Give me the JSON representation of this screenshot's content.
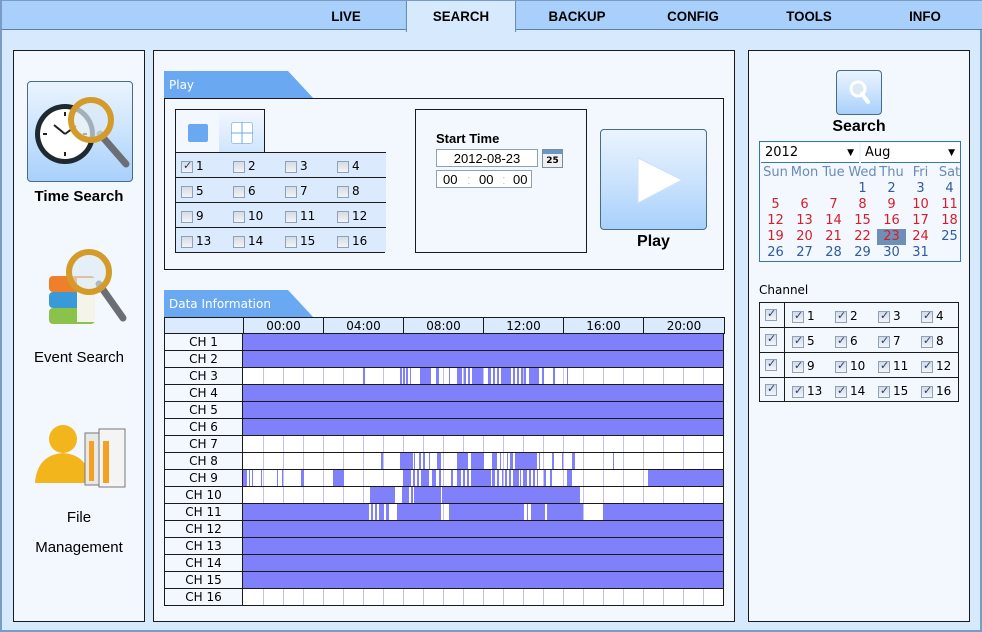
{
  "nav": {
    "tabs": [
      {
        "label": "LIVE",
        "active": false
      },
      {
        "label": "SEARCH",
        "active": true
      },
      {
        "label": "BACKUP",
        "active": false
      },
      {
        "label": "CONFIG",
        "active": false
      },
      {
        "label": "TOOLS",
        "active": false
      },
      {
        "label": "INFO",
        "active": false
      }
    ]
  },
  "sidebar": {
    "items": [
      {
        "label": "Time Search",
        "icon": "clock-magnifier-icon",
        "selected": true
      },
      {
        "label": "Event Search",
        "icon": "books-magnifier-icon",
        "selected": false
      },
      {
        "label_line1": "File",
        "label_line2": "Management",
        "icon": "user-files-icon",
        "selected": false
      }
    ]
  },
  "play_section": {
    "title": "Play",
    "layout_tabs": [
      {
        "name": "single-view",
        "active": true
      },
      {
        "name": "quad-view",
        "active": false
      }
    ],
    "channels": [
      {
        "label": "1",
        "checked": true
      },
      {
        "label": "2",
        "checked": false
      },
      {
        "label": "3",
        "checked": false
      },
      {
        "label": "4",
        "checked": false
      },
      {
        "label": "5",
        "checked": false
      },
      {
        "label": "6",
        "checked": false
      },
      {
        "label": "7",
        "checked": false
      },
      {
        "label": "8",
        "checked": false
      },
      {
        "label": "9",
        "checked": false
      },
      {
        "label": "10",
        "checked": false
      },
      {
        "label": "11",
        "checked": false
      },
      {
        "label": "12",
        "checked": false
      },
      {
        "label": "13",
        "checked": false
      },
      {
        "label": "14",
        "checked": false
      },
      {
        "label": "15",
        "checked": false
      },
      {
        "label": "16",
        "checked": false
      }
    ],
    "start_time_label": "Start Time",
    "date_value": "2012-08-23",
    "calendar_icon_text": "25",
    "time_hh": "00",
    "time_mm": "00",
    "time_ss": "00",
    "time_sep": ":",
    "play_label": "Play"
  },
  "data_info": {
    "title": "Data Information",
    "time_headers": [
      "00:00",
      "04:00",
      "08:00",
      "12:00",
      "16:00",
      "20:00"
    ],
    "record_color": "#8080fa",
    "channels": [
      {
        "label": "CH 1",
        "segments": [
          [
            0,
            24
          ]
        ]
      },
      {
        "label": "CH 2",
        "segments": [
          [
            0,
            24
          ]
        ]
      },
      {
        "label": "CH 3",
        "segments": [
          [
            6.0,
            6.08
          ],
          [
            7.85,
            7.95
          ],
          [
            8.0,
            8.1
          ],
          [
            8.15,
            8.25
          ],
          [
            8.35,
            8.42
          ],
          [
            8.85,
            9.4
          ],
          [
            9.65,
            9.8
          ],
          [
            10.3,
            10.35
          ],
          [
            10.7,
            10.95
          ],
          [
            11.05,
            11.15
          ],
          [
            11.25,
            11.35
          ],
          [
            11.45,
            12.0
          ],
          [
            12.25,
            12.4
          ],
          [
            12.5,
            12.6
          ],
          [
            12.7,
            12.8
          ],
          [
            12.9,
            13.4
          ],
          [
            13.5,
            13.6
          ],
          [
            13.7,
            13.8
          ],
          [
            13.9,
            14.0
          ],
          [
            14.05,
            14.15
          ],
          [
            14.3,
            14.8
          ],
          [
            14.95,
            15.05
          ],
          [
            15.5,
            15.6
          ],
          [
            16.2,
            16.25
          ]
        ]
      },
      {
        "label": "CH 4",
        "segments": [
          [
            0,
            24
          ]
        ]
      },
      {
        "label": "CH 5",
        "segments": [
          [
            0,
            24
          ]
        ]
      },
      {
        "label": "CH 6",
        "segments": [
          [
            0,
            24
          ]
        ]
      },
      {
        "label": "CH 7",
        "segments": []
      },
      {
        "label": "CH 8",
        "segments": [
          [
            6.9,
            7.0
          ],
          [
            7.85,
            8.5
          ],
          [
            8.55,
            8.6
          ],
          [
            8.8,
            8.9
          ],
          [
            9.0,
            9.1
          ],
          [
            9.3,
            9.35
          ],
          [
            9.7,
            9.9
          ],
          [
            10.7,
            11.25
          ],
          [
            11.4,
            12.05
          ],
          [
            12.45,
            12.7
          ],
          [
            12.85,
            12.9
          ],
          [
            13.2,
            13.25
          ],
          [
            13.35,
            13.5
          ],
          [
            13.6,
            14.7
          ],
          [
            14.8,
            14.85
          ],
          [
            15.45,
            15.55
          ],
          [
            15.95,
            16.0
          ],
          [
            16.45,
            16.6
          ],
          [
            18.5,
            18.55
          ]
        ]
      },
      {
        "label": "CH 9",
        "segments": [
          [
            0,
            0.2
          ],
          [
            0.3,
            0.35
          ],
          [
            0.45,
            0.5
          ],
          [
            0.9,
            0.95
          ],
          [
            1.7,
            1.75
          ],
          [
            1.95,
            2.0
          ],
          [
            2.9,
            3.05
          ],
          [
            4.5,
            5.05
          ],
          [
            8.0,
            8.4
          ],
          [
            8.5,
            8.6
          ],
          [
            8.7,
            8.8
          ],
          [
            8.9,
            9.3
          ],
          [
            9.45,
            9.65
          ],
          [
            9.8,
            9.9
          ],
          [
            10.4,
            10.5
          ],
          [
            10.7,
            10.9
          ],
          [
            11.0,
            11.1
          ],
          [
            11.2,
            11.3
          ],
          [
            11.4,
            12.4
          ],
          [
            12.45,
            12.6
          ],
          [
            12.7,
            12.8
          ],
          [
            12.95,
            13.0
          ],
          [
            13.1,
            13.2
          ],
          [
            13.3,
            13.4
          ],
          [
            13.5,
            13.8
          ],
          [
            13.85,
            13.9
          ],
          [
            14.0,
            14.2
          ],
          [
            14.3,
            14.4
          ],
          [
            14.5,
            14.6
          ],
          [
            14.7,
            14.75
          ],
          [
            15.05,
            15.15
          ],
          [
            15.35,
            15.45
          ],
          [
            16.2,
            16.45
          ],
          [
            20.25,
            24
          ]
        ]
      },
      {
        "label": "CH 10",
        "segments": [
          [
            6.35,
            7.6
          ],
          [
            7.95,
            8.3
          ],
          [
            8.4,
            8.5
          ],
          [
            8.55,
            9.9
          ],
          [
            9.95,
            16.85
          ]
        ]
      },
      {
        "label": "CH 11",
        "segments": [
          [
            0,
            6.3
          ],
          [
            6.4,
            6.5
          ],
          [
            6.6,
            6.7
          ],
          [
            6.8,
            7.05
          ],
          [
            7.15,
            7.3
          ],
          [
            7.7,
            9.9
          ],
          [
            10.3,
            14.05
          ],
          [
            14.2,
            14.25
          ],
          [
            14.4,
            15.1
          ],
          [
            15.2,
            17.0
          ],
          [
            18.0,
            24
          ]
        ]
      },
      {
        "label": "CH 12",
        "segments": [
          [
            0,
            24
          ]
        ]
      },
      {
        "label": "CH 13",
        "segments": [
          [
            0,
            24
          ]
        ]
      },
      {
        "label": "CH 14",
        "segments": [
          [
            0,
            24
          ]
        ]
      },
      {
        "label": "CH 15",
        "segments": [
          [
            0,
            24
          ]
        ]
      },
      {
        "label": "CH 16",
        "segments": []
      }
    ]
  },
  "search_panel": {
    "search_label": "Search",
    "year_value": "2012",
    "month_value": "Aug",
    "weekdays": [
      "Sun",
      "Mon",
      "Tue",
      "Wed",
      "Thu",
      "Fri",
      "Sat"
    ],
    "first_weekday_index": 3,
    "days_in_month": 31,
    "selected_day": 23,
    "recorded_days": [
      5,
      6,
      7,
      8,
      9,
      10,
      11,
      12,
      13,
      14,
      15,
      16,
      17,
      18,
      19,
      20,
      21,
      22,
      23,
      24
    ],
    "colors": {
      "normal_day": "#2e5c9e",
      "recorded_day": "#d41f2a",
      "selected_bg": "#6e8fb6",
      "weekday_header": "#6a8bb8"
    },
    "channel_label": "Channel",
    "channel_rows": [
      {
        "row_checked": true,
        "channels": [
          {
            "label": "1",
            "checked": true
          },
          {
            "label": "2",
            "checked": true
          },
          {
            "label": "3",
            "checked": true
          },
          {
            "label": "4",
            "checked": true
          }
        ]
      },
      {
        "row_checked": true,
        "channels": [
          {
            "label": "5",
            "checked": true
          },
          {
            "label": "6",
            "checked": true
          },
          {
            "label": "7",
            "checked": true
          },
          {
            "label": "8",
            "checked": true
          }
        ]
      },
      {
        "row_checked": true,
        "channels": [
          {
            "label": "9",
            "checked": true
          },
          {
            "label": "10",
            "checked": true
          },
          {
            "label": "11",
            "checked": true
          },
          {
            "label": "12",
            "checked": true
          }
        ]
      },
      {
        "row_checked": true,
        "channels": [
          {
            "label": "13",
            "checked": true
          },
          {
            "label": "14",
            "checked": true
          },
          {
            "label": "15",
            "checked": true
          },
          {
            "label": "16",
            "checked": true
          }
        ]
      }
    ]
  }
}
